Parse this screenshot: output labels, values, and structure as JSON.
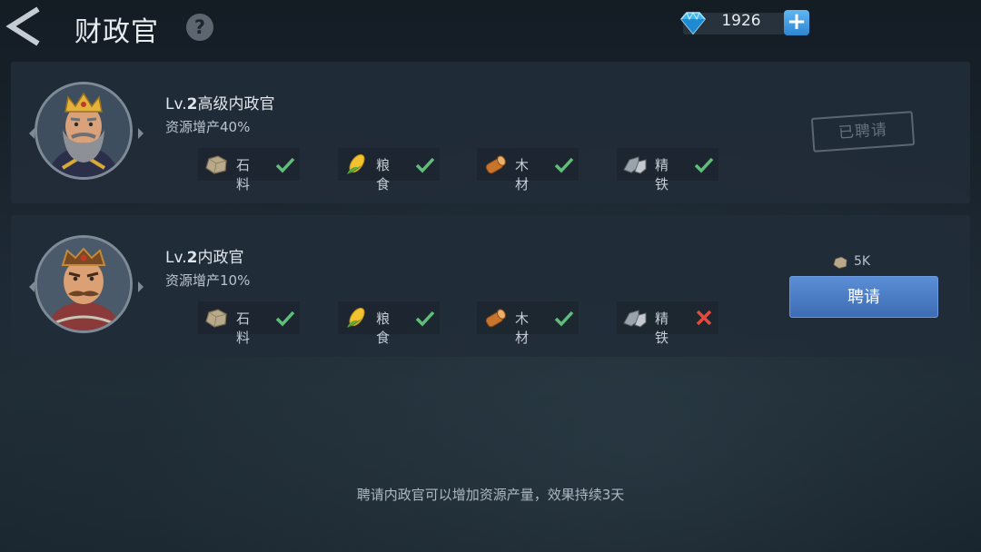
{
  "header": {
    "title": "财政官",
    "help_label": "?",
    "gems": "1926",
    "plus_label": "+"
  },
  "officers": [
    {
      "level_prefix": "Lv.",
      "level": "2",
      "name": "高级内政官",
      "bonus_prefix": "资源增产",
      "bonus_value": "40%",
      "resources": [
        {
          "label": "石料",
          "icon": "stone-icon",
          "ok": true
        },
        {
          "label": "粮食",
          "icon": "corn-icon",
          "ok": true
        },
        {
          "label": "木材",
          "icon": "wood-icon",
          "ok": true
        },
        {
          "label": "精铁",
          "icon": "iron-icon",
          "ok": true
        }
      ],
      "status": "已聘请"
    },
    {
      "level_prefix": "Lv.",
      "level": "2",
      "name": "内政官",
      "bonus_prefix": "资源增产",
      "bonus_value": "10%",
      "resources": [
        {
          "label": "石料",
          "icon": "stone-icon",
          "ok": true
        },
        {
          "label": "粮食",
          "icon": "corn-icon",
          "ok": true
        },
        {
          "label": "木材",
          "icon": "wood-icon",
          "ok": true
        },
        {
          "label": "精铁",
          "icon": "iron-icon",
          "ok": false
        }
      ],
      "cost": "5K",
      "cost_icon": "stone-icon",
      "hire_label": "聘请"
    }
  ],
  "footer_note": "聘请内政官可以增加资源产量，效果持续3天",
  "colors": {
    "check": "#5fbf7a",
    "cross": "#e04a3f",
    "hire_button": "#4a7cc4"
  }
}
